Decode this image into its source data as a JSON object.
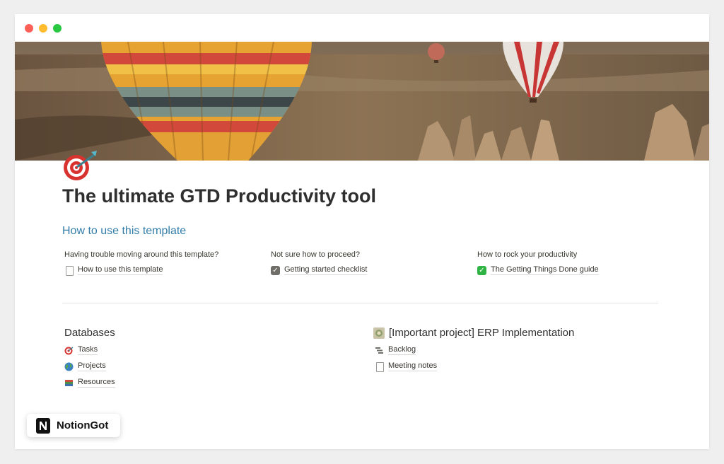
{
  "window": {
    "controls": [
      "close",
      "minimize",
      "maximize"
    ]
  },
  "cover": {
    "description_icon": "hot-air-balloons-cover-image"
  },
  "page": {
    "icon": "direct-hit-target-icon",
    "title": "The ultimate GTD Productivity tool",
    "section_heading": "How to use this template",
    "columns": [
      {
        "caption": "Having trouble moving around this template?",
        "link": "How to use this template",
        "icon": "page-icon"
      },
      {
        "caption": "Not sure how to proceed?",
        "link": "Getting started checklist",
        "icon": "checkbox-icon"
      },
      {
        "caption": "How to rock your productivity",
        "link": "The Getting Things Done guide",
        "icon": "green-check-icon"
      }
    ],
    "databases": {
      "heading": "Databases",
      "items": [
        {
          "label": "Tasks",
          "icon": "target-icon"
        },
        {
          "label": "Projects",
          "icon": "globe-icon"
        },
        {
          "label": "Resources",
          "icon": "books-icon"
        }
      ]
    },
    "project": {
      "heading": "[Important project] ERP Implementation",
      "icon": "project-image-icon",
      "items": [
        {
          "label": "Backlog",
          "icon": "backlog-icon"
        },
        {
          "label": "Meeting notes",
          "icon": "page-icon"
        }
      ]
    }
  },
  "badge": {
    "logo": "N",
    "label": "NotionGot"
  },
  "colors": {
    "accent": "#337ea9",
    "text": "#2f2f2f",
    "background": "#efefef"
  }
}
